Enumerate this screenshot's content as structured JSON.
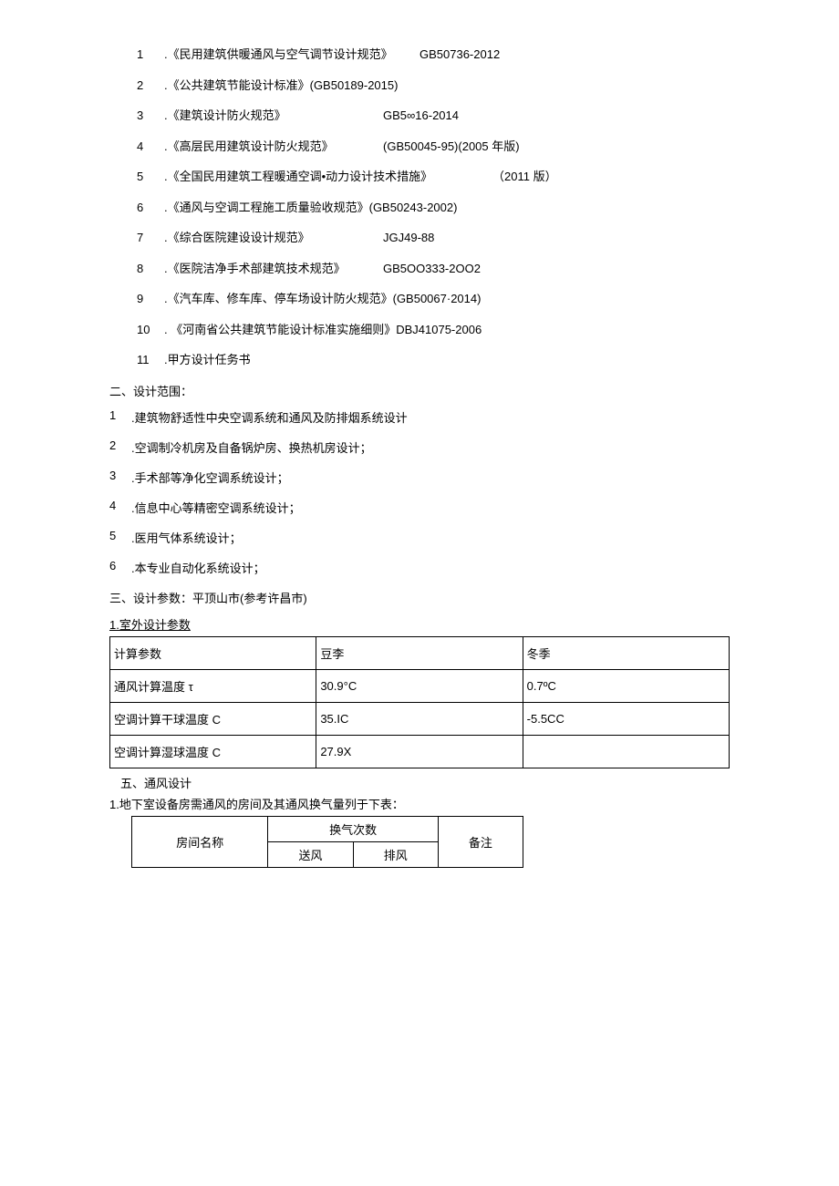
{
  "references": [
    {
      "num": "1",
      "title": ".《民用建筑供暖通风与空气调节设计规范》",
      "code": "GB50736-2012"
    },
    {
      "num": "2",
      "title": ".《公共建筑节能设计标准》(GB50189-2015)",
      "code": ""
    },
    {
      "num": "3",
      "title": ".《建筑设计防火规范》",
      "code": "GB5∞16-2014"
    },
    {
      "num": "4",
      "title": ".《高层民用建筑设计防火规范》",
      "code": "(GB50045-95)(2005 年版)"
    },
    {
      "num": "5",
      "title": ".《全国民用建筑工程暖通空调•动力设计技术措施》",
      "code": "（2011 版）"
    },
    {
      "num": "6",
      "title": ".《通风与空调工程施工质量验收规范》(GB50243-2002)",
      "code": ""
    },
    {
      "num": "7",
      "title": ".《综合医院建设设计规范》",
      "code": "JGJ49-88"
    },
    {
      "num": "8",
      "title": ".《医院洁净手术部建筑技术规范》",
      "code": "GB5OO333-2OO2"
    },
    {
      "num": "9",
      "title": ".《汽车库、修车库、停车场设计防火规范》(GB50067·2014)",
      "code": ""
    },
    {
      "num": "10",
      "title": ". 《河南省公共建筑节能设计标准实施细则》DBJ41075-2006",
      "code": ""
    },
    {
      "num": "11",
      "title": ".甲方设计任务书",
      "code": ""
    }
  ],
  "section2_title": "二、设计范围：",
  "scope": [
    {
      "num": "1",
      "text": ".建筑物舒适性中央空调系统和通风及防排烟系统设计"
    },
    {
      "num": "2",
      "text": ".空调制冷机房及自备锅炉房、换热机房设计；"
    },
    {
      "num": "3",
      "text": ".手术部等净化空调系统设计；"
    },
    {
      "num": "4",
      "text": ".信息中心等精密空调系统设计；"
    },
    {
      "num": "5",
      "text": ".医用气体系统设计；"
    },
    {
      "num": "6",
      "text": ".本专业自动化系统设计；"
    }
  ],
  "section3_title": "三、设计参数：平顶山市(参考许昌市)",
  "outdoor_title": "1.室外设计参数",
  "param_table": {
    "headers": [
      "计算参数",
      "豆李",
      "冬季"
    ],
    "rows": [
      [
        "通风计算温度 τ",
        "30.9°C",
        "0.7ºC"
      ],
      [
        "空调计算干球温度 C",
        "35.IC",
        "-5.5CC"
      ],
      [
        "空调计算湿球温度 C",
        "27.9X",
        ""
      ]
    ]
  },
  "section5_title": "五、通风设计",
  "basement_title": "1.地下室设备房需通风的房间及其通风换气量列于下表：",
  "room_table": {
    "col1": "房间名称",
    "merged": "换气次数",
    "sub1": "送风",
    "sub2": "排风",
    "col4": "备注"
  }
}
